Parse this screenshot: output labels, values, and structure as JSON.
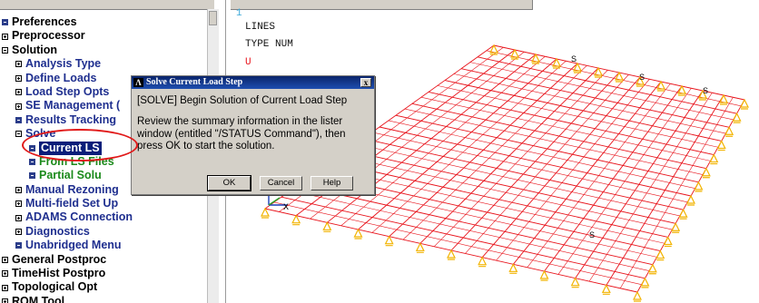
{
  "tree": {
    "items": [
      {
        "label": "Preferences",
        "level": 0,
        "marker": "doc",
        "style": ""
      },
      {
        "label": "Preprocessor",
        "level": 0,
        "marker": "plus",
        "style": ""
      },
      {
        "label": "Solution",
        "level": 0,
        "marker": "minus",
        "style": ""
      },
      {
        "label": "Analysis Type",
        "level": 1,
        "marker": "plus",
        "style": "blue"
      },
      {
        "label": "Define Loads",
        "level": 1,
        "marker": "plus",
        "style": "blue"
      },
      {
        "label": "Load Step Opts",
        "level": 1,
        "marker": "plus",
        "style": "blue"
      },
      {
        "label": "SE Management (",
        "level": 1,
        "marker": "plus",
        "style": "blue"
      },
      {
        "label": "Results Tracking",
        "level": 1,
        "marker": "doc",
        "style": "blue"
      },
      {
        "label": "Solve",
        "level": 1,
        "marker": "minus",
        "style": "blue"
      },
      {
        "label": "Current LS",
        "level": 2,
        "marker": "doc",
        "style": "sel"
      },
      {
        "label": "From LS Files",
        "level": 2,
        "marker": "doc",
        "style": "green"
      },
      {
        "label": "Partial Solu",
        "level": 2,
        "marker": "doc",
        "style": "green"
      },
      {
        "label": "Manual Rezoning",
        "level": 1,
        "marker": "plus",
        "style": "blue"
      },
      {
        "label": "Multi-field Set Up",
        "level": 1,
        "marker": "plus",
        "style": "blue"
      },
      {
        "label": "ADAMS Connection",
        "level": 1,
        "marker": "plus",
        "style": "blue"
      },
      {
        "label": "Diagnostics",
        "level": 1,
        "marker": "plus",
        "style": "blue"
      },
      {
        "label": "Unabridged Menu",
        "level": 1,
        "marker": "doc",
        "style": "blue"
      },
      {
        "label": "General Postproc",
        "level": 0,
        "marker": "plus",
        "style": ""
      },
      {
        "label": "TimeHist Postpro",
        "level": 0,
        "marker": "plus",
        "style": ""
      },
      {
        "label": "Topological Opt",
        "level": 0,
        "marker": "plus",
        "style": ""
      },
      {
        "label": "ROM Tool",
        "level": 0,
        "marker": "plus",
        "style": ""
      }
    ]
  },
  "graphics": {
    "window_number": "1",
    "line1": "LINES",
    "line2": "TYPE NUM",
    "line3": "U",
    "axis_label": "X",
    "symbol_label": "S",
    "mesh_color": "#e8121a",
    "support_color": "#f2b400"
  },
  "dialog": {
    "title": "Solve Current Load Step",
    "logo": "Λ",
    "close": "x",
    "heading": "[SOLVE] Begin Solution of Current Load Step",
    "body": "Review the summary information in the lister window (entitled  \"/STATUS Command\"), then press OK to start the solution.",
    "ok": "OK",
    "cancel": "Cancel",
    "help": "Help"
  },
  "colors": {
    "highlight_circle": "#e11919",
    "title_bar": "#0a246a",
    "selection": "#0a1e7a"
  }
}
